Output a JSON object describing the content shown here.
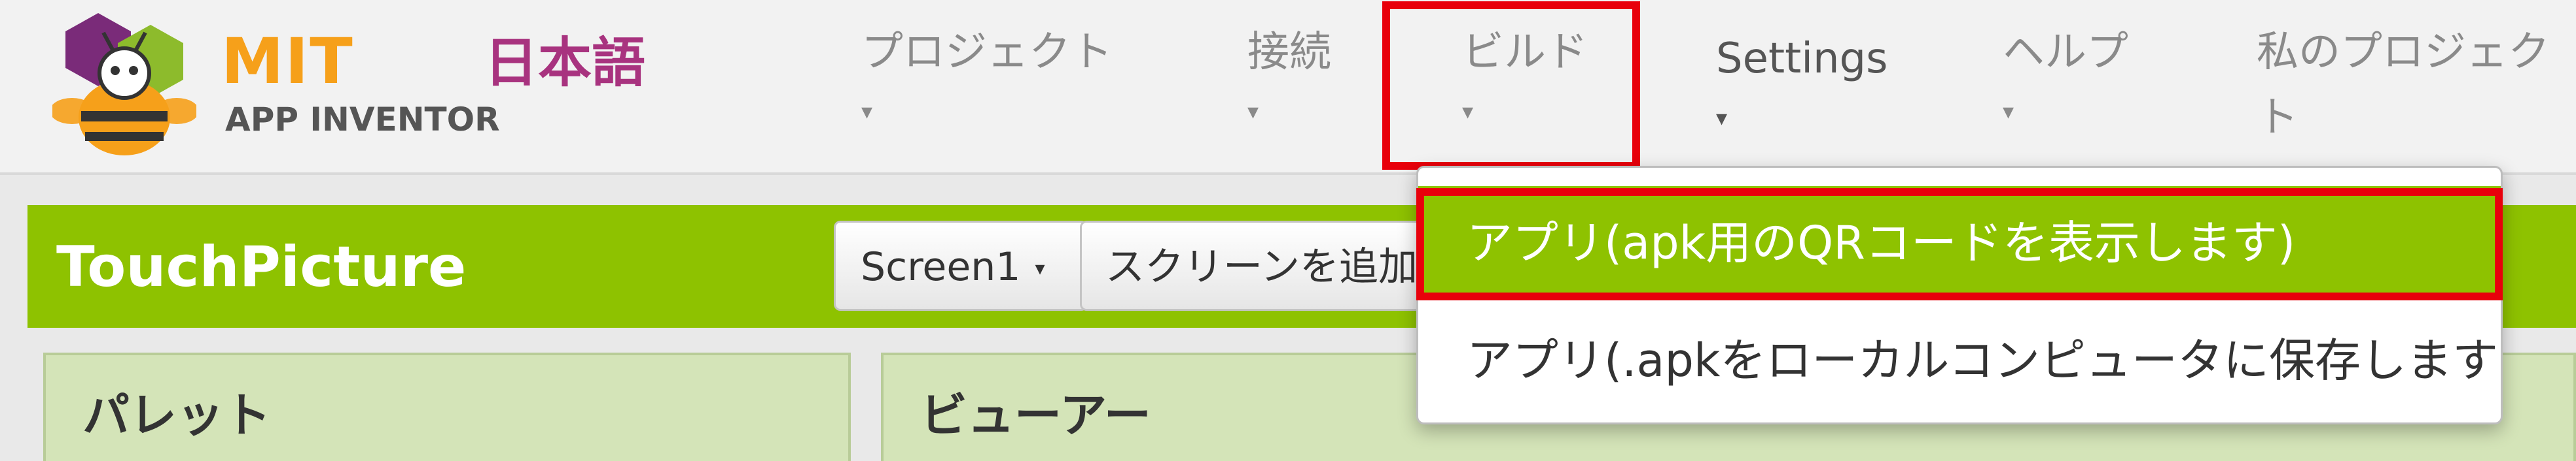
{
  "brand": {
    "mit": "MIT",
    "app_inventor": "APP INVENTOR",
    "language": "日本語"
  },
  "nav": {
    "project": "プロジェクト",
    "connect": "接続",
    "build": "ビルド",
    "settings": "Settings",
    "help": "ヘルプ",
    "my_projects_line1": "私のプロジェク",
    "my_projects_line2": "ト",
    "caret": "▾"
  },
  "project_bar": {
    "title": "TouchPicture",
    "screen_select": "Screen1",
    "screen_caret": "▾",
    "add_screen": "スクリーンを追加"
  },
  "panels": {
    "palette_title": "パレット",
    "viewer_title": "ビューアー"
  },
  "build_menu": {
    "items": [
      {
        "label": "アプリ(apk用のQRコードを表示します)",
        "state": "hovered"
      },
      {
        "label": "アプリ(.apkをローカルコンピュータに保存します)",
        "state": "normal"
      }
    ]
  },
  "colors": {
    "accent_green": "#8ec200",
    "highlight_red": "#e8000b",
    "mit_orange": "#f6a01a",
    "language_magenta": "#a8337f"
  },
  "icons": {
    "logo": "app-inventor-bee-logo"
  }
}
